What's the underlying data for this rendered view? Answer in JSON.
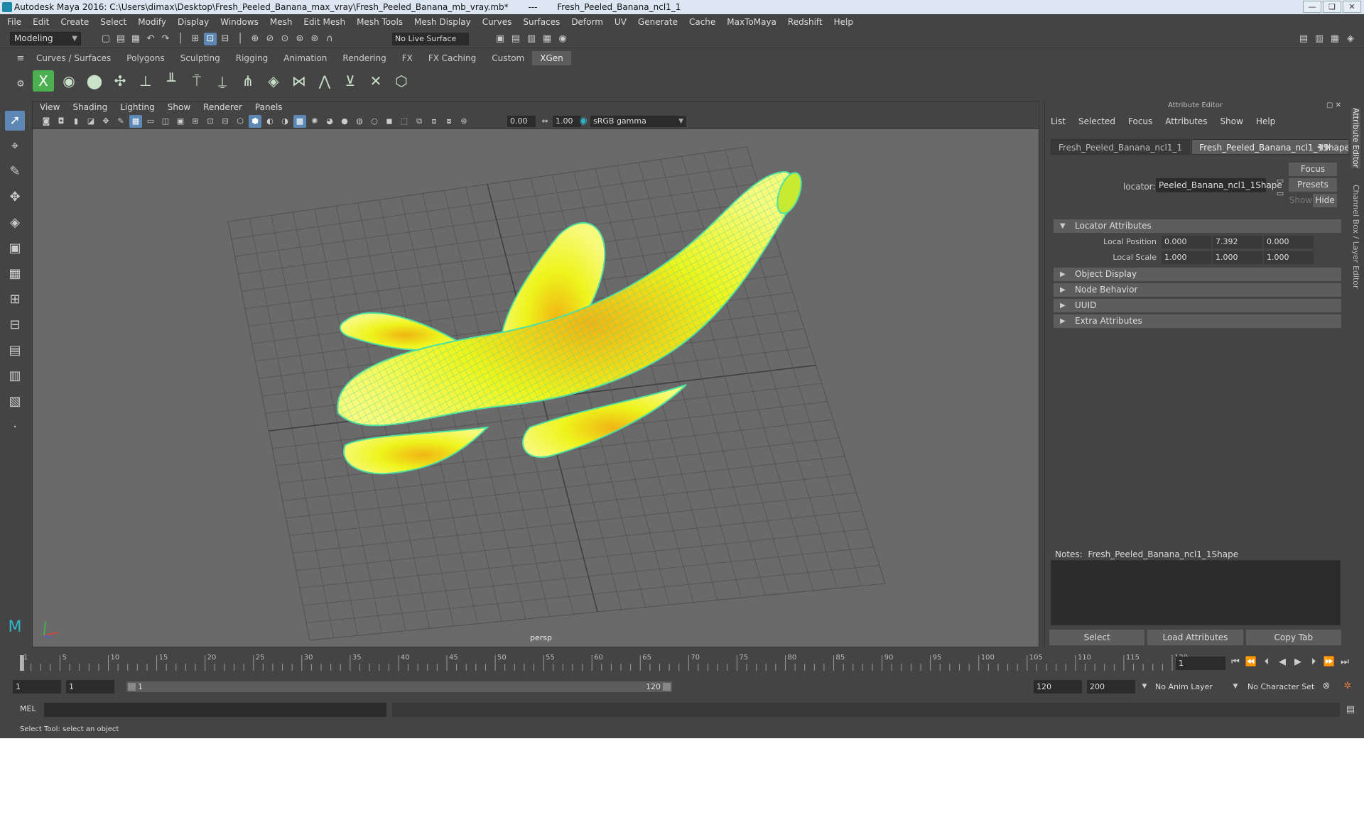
{
  "window": {
    "title_left": "Autodesk Maya 2016: C:\\Users\\dimax\\Desktop\\Fresh_Peeled_Banana_max_vray\\Fresh_Peeled_Banana_mb_vray.mb*",
    "title_sep": "---",
    "title_right": "Fresh_Peeled_Banana_ncl1_1",
    "buttons": [
      "—",
      "❏",
      "✕"
    ]
  },
  "menubar": [
    "File",
    "Edit",
    "Create",
    "Select",
    "Modify",
    "Display",
    "Windows",
    "Mesh",
    "Edit Mesh",
    "Mesh Tools",
    "Mesh Display",
    "Curves",
    "Surfaces",
    "Deform",
    "UV",
    "Generate",
    "Cache",
    "MaxToMaya",
    "Redshift",
    "Help"
  ],
  "statusline": {
    "mode": "Modeling",
    "live_surface": "No Live Surface"
  },
  "shelf_tabs": [
    "Curves / Surfaces",
    "Polygons",
    "Sculpting",
    "Rigging",
    "Animation",
    "Rendering",
    "FX",
    "FX Caching",
    "Custom",
    "XGen"
  ],
  "shelf_active": "XGen",
  "viewport": {
    "menu": [
      "View",
      "Shading",
      "Lighting",
      "Show",
      "Renderer",
      "Panels"
    ],
    "exposure": "0.00",
    "gamma_value": "1.00",
    "color_space": "sRGB gamma",
    "camera_label": "persp"
  },
  "attribute_editor": {
    "title": "Attribute Editor",
    "menu": [
      "List",
      "Selected",
      "Focus",
      "Attributes",
      "Show",
      "Help"
    ],
    "tabs": [
      "Fresh_Peeled_Banana_ncl1_1",
      "Fresh_Peeled_Banana_ncl1_1Shape"
    ],
    "locator_label": "locator:",
    "locator_value": "Peeled_Banana_ncl1_1Shape",
    "focus_btn": "Focus",
    "presets_btn": "Presets",
    "show_btn": "Show",
    "hide_btn": "Hide",
    "sections": {
      "locator": "Locator Attributes",
      "object_display": "Object Display",
      "node_behavior": "Node Behavior",
      "uuid": "UUID",
      "extra": "Extra Attributes"
    },
    "local_position": {
      "label": "Local Position",
      "x": "0.000",
      "y": "7.392",
      "z": "0.000"
    },
    "local_scale": {
      "label": "Local Scale",
      "x": "1.000",
      "y": "1.000",
      "z": "1.000"
    },
    "notes_label": "Notes:",
    "notes_node": "Fresh_Peeled_Banana_ncl1_1Shape",
    "buttons": {
      "select": "Select",
      "load": "Load Attributes",
      "copy": "Copy Tab"
    }
  },
  "right_strip": [
    "Attribute Editor",
    "Channel Box / Layer Editor"
  ],
  "timeline": {
    "ticks": [
      "1",
      "5",
      "10",
      "15",
      "20",
      "25",
      "30",
      "35",
      "40",
      "45",
      "50",
      "55",
      "60",
      "65",
      "70",
      "75",
      "80",
      "85",
      "90",
      "95",
      "100",
      "105",
      "110",
      "115",
      "120"
    ],
    "current_frame": "1"
  },
  "range": {
    "start": "1",
    "playback_start": "1",
    "slider_start": "1",
    "slider_end": "120",
    "playback_end": "120",
    "end": "200",
    "anim_layer": "No Anim Layer",
    "character_set": "No Character Set"
  },
  "command": {
    "label": "MEL"
  },
  "help_line": "Select Tool: select an object",
  "colors": {
    "accent": "#5d87b5",
    "mesh": "#e8f020",
    "wire": "#4fe0a0",
    "viewport_bg": "#6a6a6a"
  }
}
